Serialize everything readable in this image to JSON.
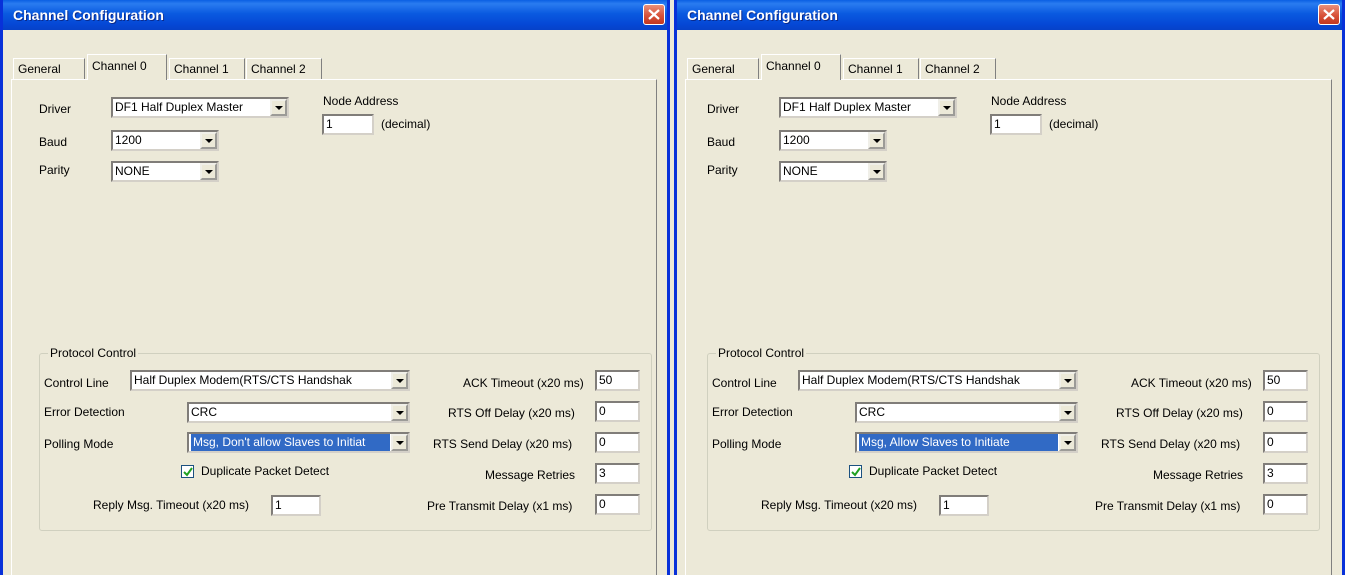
{
  "windows": [
    {
      "title": "Channel Configuration",
      "tabs": [
        "General",
        "Channel 0",
        "Channel 1",
        "Channel 2"
      ],
      "active_tab": "Channel 0",
      "driver_label": "Driver",
      "driver_value": "DF1 Half Duplex Master",
      "baud_label": "Baud",
      "baud_value": "1200",
      "parity_label": "Parity",
      "parity_value": "NONE",
      "node_address_label": "Node Address",
      "node_address_value": "1",
      "node_address_unit": "(decimal)",
      "protocol": {
        "group_label": "Protocol Control",
        "control_line_label": "Control Line",
        "control_line_value": "Half Duplex Modem(RTS/CTS Handshak",
        "error_detection_label": "Error Detection",
        "error_detection_value": "CRC",
        "polling_mode_label": "Polling Mode",
        "polling_mode_value": "Msg, Don't allow Slaves to Initiat",
        "duplicate_packet_label": "Duplicate Packet Detect",
        "duplicate_packet_checked": true,
        "reply_timeout_label": "Reply Msg. Timeout (x20 ms)",
        "reply_timeout_value": "1",
        "ack_timeout_label": "ACK Timeout (x20 ms)",
        "ack_timeout_value": "50",
        "rts_off_label": "RTS Off Delay (x20 ms)",
        "rts_off_value": "0",
        "rts_send_label": "RTS Send Delay (x20 ms)",
        "rts_send_value": "0",
        "retries_label": "Message Retries",
        "retries_value": "3",
        "pre_transmit_label": "Pre Transmit Delay (x1 ms)",
        "pre_transmit_value": "0"
      }
    },
    {
      "title": "Channel Configuration",
      "tabs": [
        "General",
        "Channel 0",
        "Channel 1",
        "Channel 2"
      ],
      "active_tab": "Channel 0",
      "driver_label": "Driver",
      "driver_value": "DF1 Half Duplex Master",
      "baud_label": "Baud",
      "baud_value": "1200",
      "parity_label": "Parity",
      "parity_value": "NONE",
      "node_address_label": "Node Address",
      "node_address_value": "1",
      "node_address_unit": "(decimal)",
      "protocol": {
        "group_label": "Protocol Control",
        "control_line_label": "Control Line",
        "control_line_value": "Half Duplex Modem(RTS/CTS Handshak",
        "error_detection_label": "Error Detection",
        "error_detection_value": "CRC",
        "polling_mode_label": "Polling Mode",
        "polling_mode_value": "Msg, Allow Slaves to Initiate",
        "duplicate_packet_label": "Duplicate Packet Detect",
        "duplicate_packet_checked": true,
        "reply_timeout_label": "Reply Msg. Timeout (x20 ms)",
        "reply_timeout_value": "1",
        "ack_timeout_label": "ACK Timeout (x20 ms)",
        "ack_timeout_value": "50",
        "rts_off_label": "RTS Off Delay (x20 ms)",
        "rts_off_value": "0",
        "rts_send_label": "RTS Send Delay (x20 ms)",
        "rts_send_value": "0",
        "retries_label": "Message Retries",
        "retries_value": "3",
        "pre_transmit_label": "Pre Transmit Delay (x1 ms)",
        "pre_transmit_value": "0"
      }
    }
  ],
  "icons": {
    "close": "close-icon",
    "dropdown": "chevron-down-icon",
    "check": "checkmark-icon"
  },
  "colors": {
    "titlebar": "#0a5ae0",
    "selection": "#316ac5",
    "face": "#ece9d8",
    "close_button": "#d8523a"
  }
}
